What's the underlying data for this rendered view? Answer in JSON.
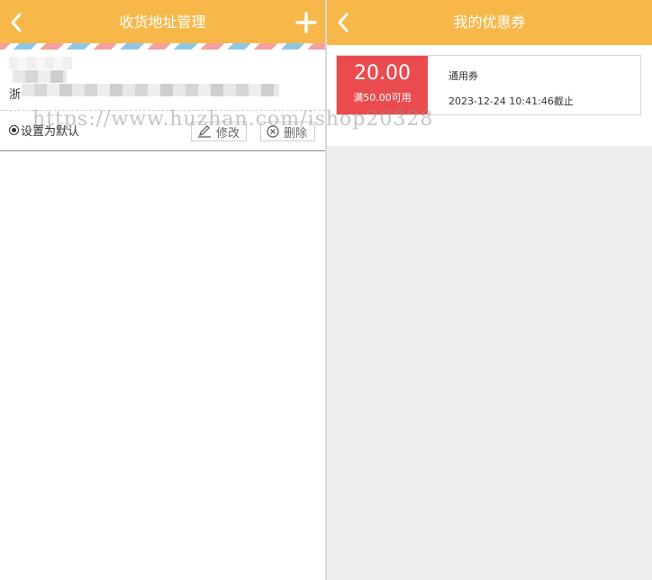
{
  "left_screen": {
    "title": "收货地址管理",
    "back_icon": "chevron-left-icon",
    "add_icon": "plus-icon",
    "address": {
      "province": "浙",
      "default_label": "设置为默认",
      "edit_label": "修改",
      "delete_label": "删除",
      "edit_icon": "pencil-icon",
      "delete_icon": "circle-x-icon"
    }
  },
  "right_screen": {
    "title": "我的优惠券",
    "back_icon": "chevron-left-icon",
    "coupon": {
      "amount": "20.00",
      "condition": "满50.00可用",
      "type": "通用券",
      "expire": "2023-12-24 10:41:46截止"
    }
  },
  "watermark": "https://www.huzhan.com/ishop20328",
  "colors": {
    "header": "#f8b849",
    "coupon_red": "#ea4b4f",
    "stripe_red": "#f3a0a0",
    "stripe_blue": "#8fc6e8"
  }
}
